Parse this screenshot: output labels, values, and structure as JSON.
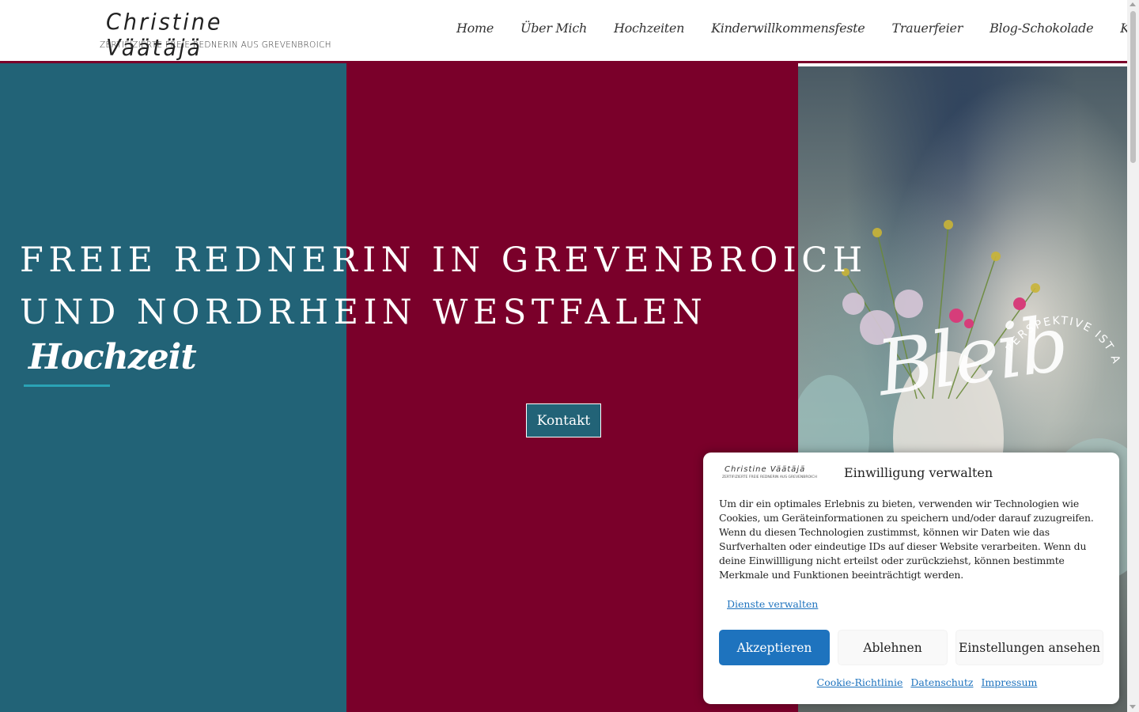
{
  "logo": {
    "name": "Christine Väätäjä",
    "tagline": "ZERTIFIZIERTE FREIE REDNERIN AUS GREVENBROICH"
  },
  "nav": {
    "items": [
      {
        "label": "Home"
      },
      {
        "label": "Über Mich"
      },
      {
        "label": "Hochzeiten"
      },
      {
        "label": "Kinderwillkommensfeste"
      },
      {
        "label": "Trauerfeier"
      },
      {
        "label": "Blog-Schokolade"
      },
      {
        "label": "Kontakt"
      }
    ]
  },
  "hero": {
    "title_line1": "FREIE REDNERIN IN GREVENBROICH",
    "title_line2": "UND NORDRHEIN WESTFALEN",
    "rotating_word": "Hochzeit",
    "cta_label": "Kontakt",
    "photo_script": "Bleib",
    "photo_arc_text": "PERSPEKTIVE IST ALLES."
  },
  "colors": {
    "teal": "#226377",
    "burgundy": "#7a002a",
    "link_blue": "#1e73be",
    "underline_accent": "#2aa3b5"
  },
  "cookie": {
    "logo_name": "Christine Väätäjä",
    "logo_tagline": "ZERTIFIZIERTE FREIE REDNERIN AUS GREVENBROICH",
    "title": "Einwilligung verwalten",
    "text": "Um dir ein optimales Erlebnis zu bieten, verwenden wir Technologien wie Cookies, um Geräteinformationen zu speichern und/oder darauf zuzugreifen. Wenn du diesen Technologien zustimmst, können wir Daten wie das Surfverhalten oder eindeutige IDs auf dieser Website verarbeiten. Wenn du deine Einwillligung nicht erteilst oder zurückziehst, können bestimmte Merkmale und Funktionen beeinträchtigt werden.",
    "manage_link": "Dienste verwalten",
    "accept": "Akzeptieren",
    "deny": "Ablehnen",
    "preferences": "Einstellungen ansehen",
    "links": [
      {
        "label": "Cookie-Richtlinie"
      },
      {
        "label": "Datenschutz"
      },
      {
        "label": "Impressum"
      }
    ]
  }
}
